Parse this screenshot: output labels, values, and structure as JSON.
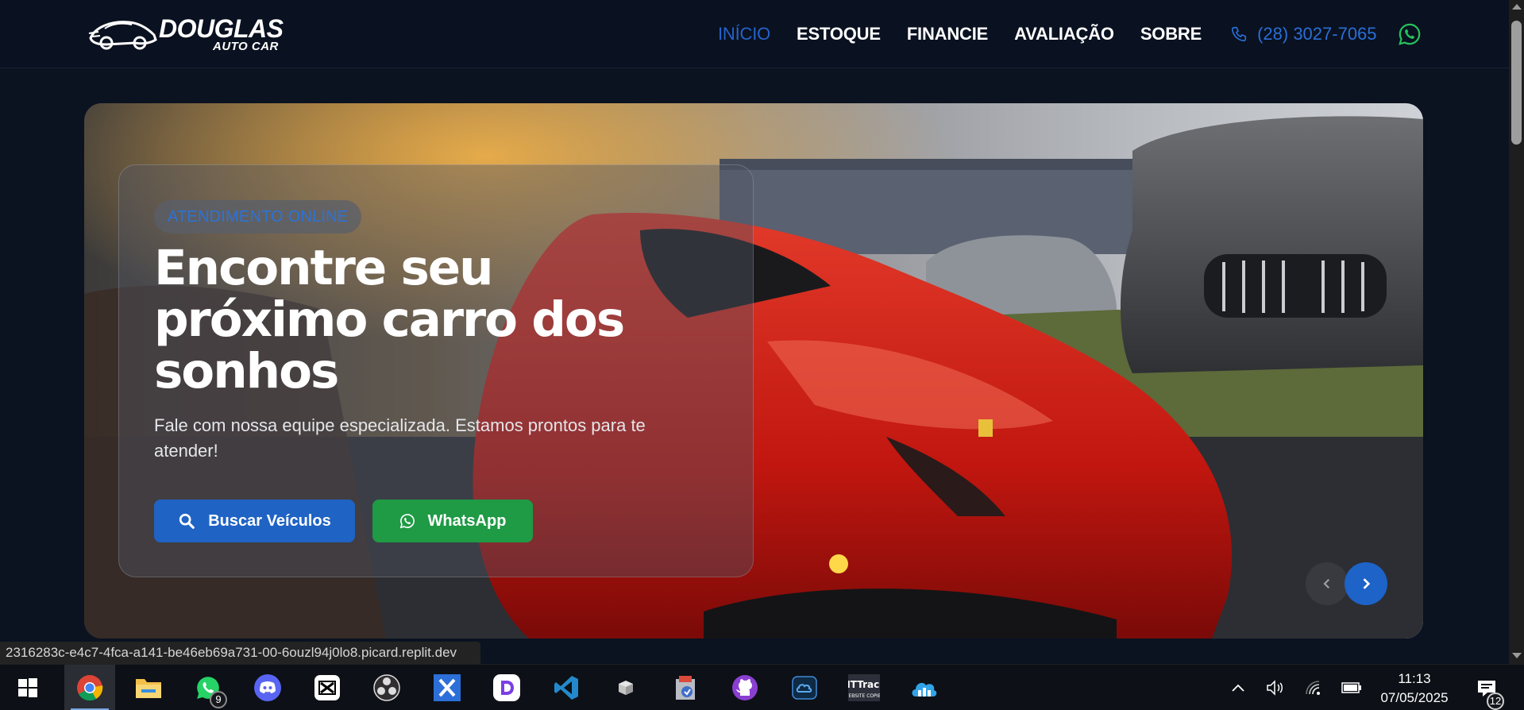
{
  "header": {
    "logo": {
      "name": "DOUGLAS",
      "sub": "AUTO CAR",
      "icon": "car-logo-icon"
    },
    "nav": [
      {
        "label": "INÍCIO",
        "active": true
      },
      {
        "label": "ESTOQUE",
        "active": false
      },
      {
        "label": "FINANCIE",
        "active": false
      },
      {
        "label": "AVALIAÇÃO",
        "active": false
      },
      {
        "label": "SOBRE",
        "active": false
      }
    ],
    "phone": {
      "icon": "phone-icon",
      "text": "(28) 3027-7065"
    },
    "whatsapp_icon": "whatsapp-icon"
  },
  "hero": {
    "badge": "ATENDIMENTO ONLINE",
    "title": "Encontre seu próximo carro dos sonhos",
    "subtitle": "Fale com nossa equipe especializada. Estamos prontos para te atender!",
    "buttons": {
      "search": {
        "label": "Buscar Veículos",
        "icon": "search-icon"
      },
      "whatsapp": {
        "label": "WhatsApp",
        "icon": "whatsapp-icon"
      }
    },
    "carousel": {
      "prev_icon": "chevron-left-icon",
      "next_icon": "chevron-right-icon"
    }
  },
  "status_url": "2316283c-e4c7-4fca-a141-be46eb69a731-00-6ouzl94j0lo8.picard.replit.dev",
  "taskbar": {
    "apps": [
      {
        "name": "start-icon"
      },
      {
        "name": "chrome-icon",
        "active": true
      },
      {
        "name": "file-explorer-icon"
      },
      {
        "name": "whatsapp-icon",
        "badge": "9"
      },
      {
        "name": "discord-icon"
      },
      {
        "name": "capcut-icon"
      },
      {
        "name": "obs-icon"
      },
      {
        "name": "app-x-icon"
      },
      {
        "name": "app-d-icon"
      },
      {
        "name": "vscode-icon"
      },
      {
        "name": "cube-icon"
      },
      {
        "name": "installer-icon"
      },
      {
        "name": "github-icon"
      },
      {
        "name": "app-cloud-icon"
      },
      {
        "name": "httrack-icon"
      },
      {
        "name": "network-cloud-icon"
      }
    ],
    "tray": [
      "chevron-up-icon",
      "volume-icon",
      "wifi-icon",
      "battery-icon"
    ],
    "time": "11:13",
    "date": "07/05/2025",
    "notifications": "12"
  },
  "colors": {
    "accent_blue": "#1f63c4",
    "whatsapp_green": "#1f9a45",
    "page_bg": "#0b1220"
  }
}
